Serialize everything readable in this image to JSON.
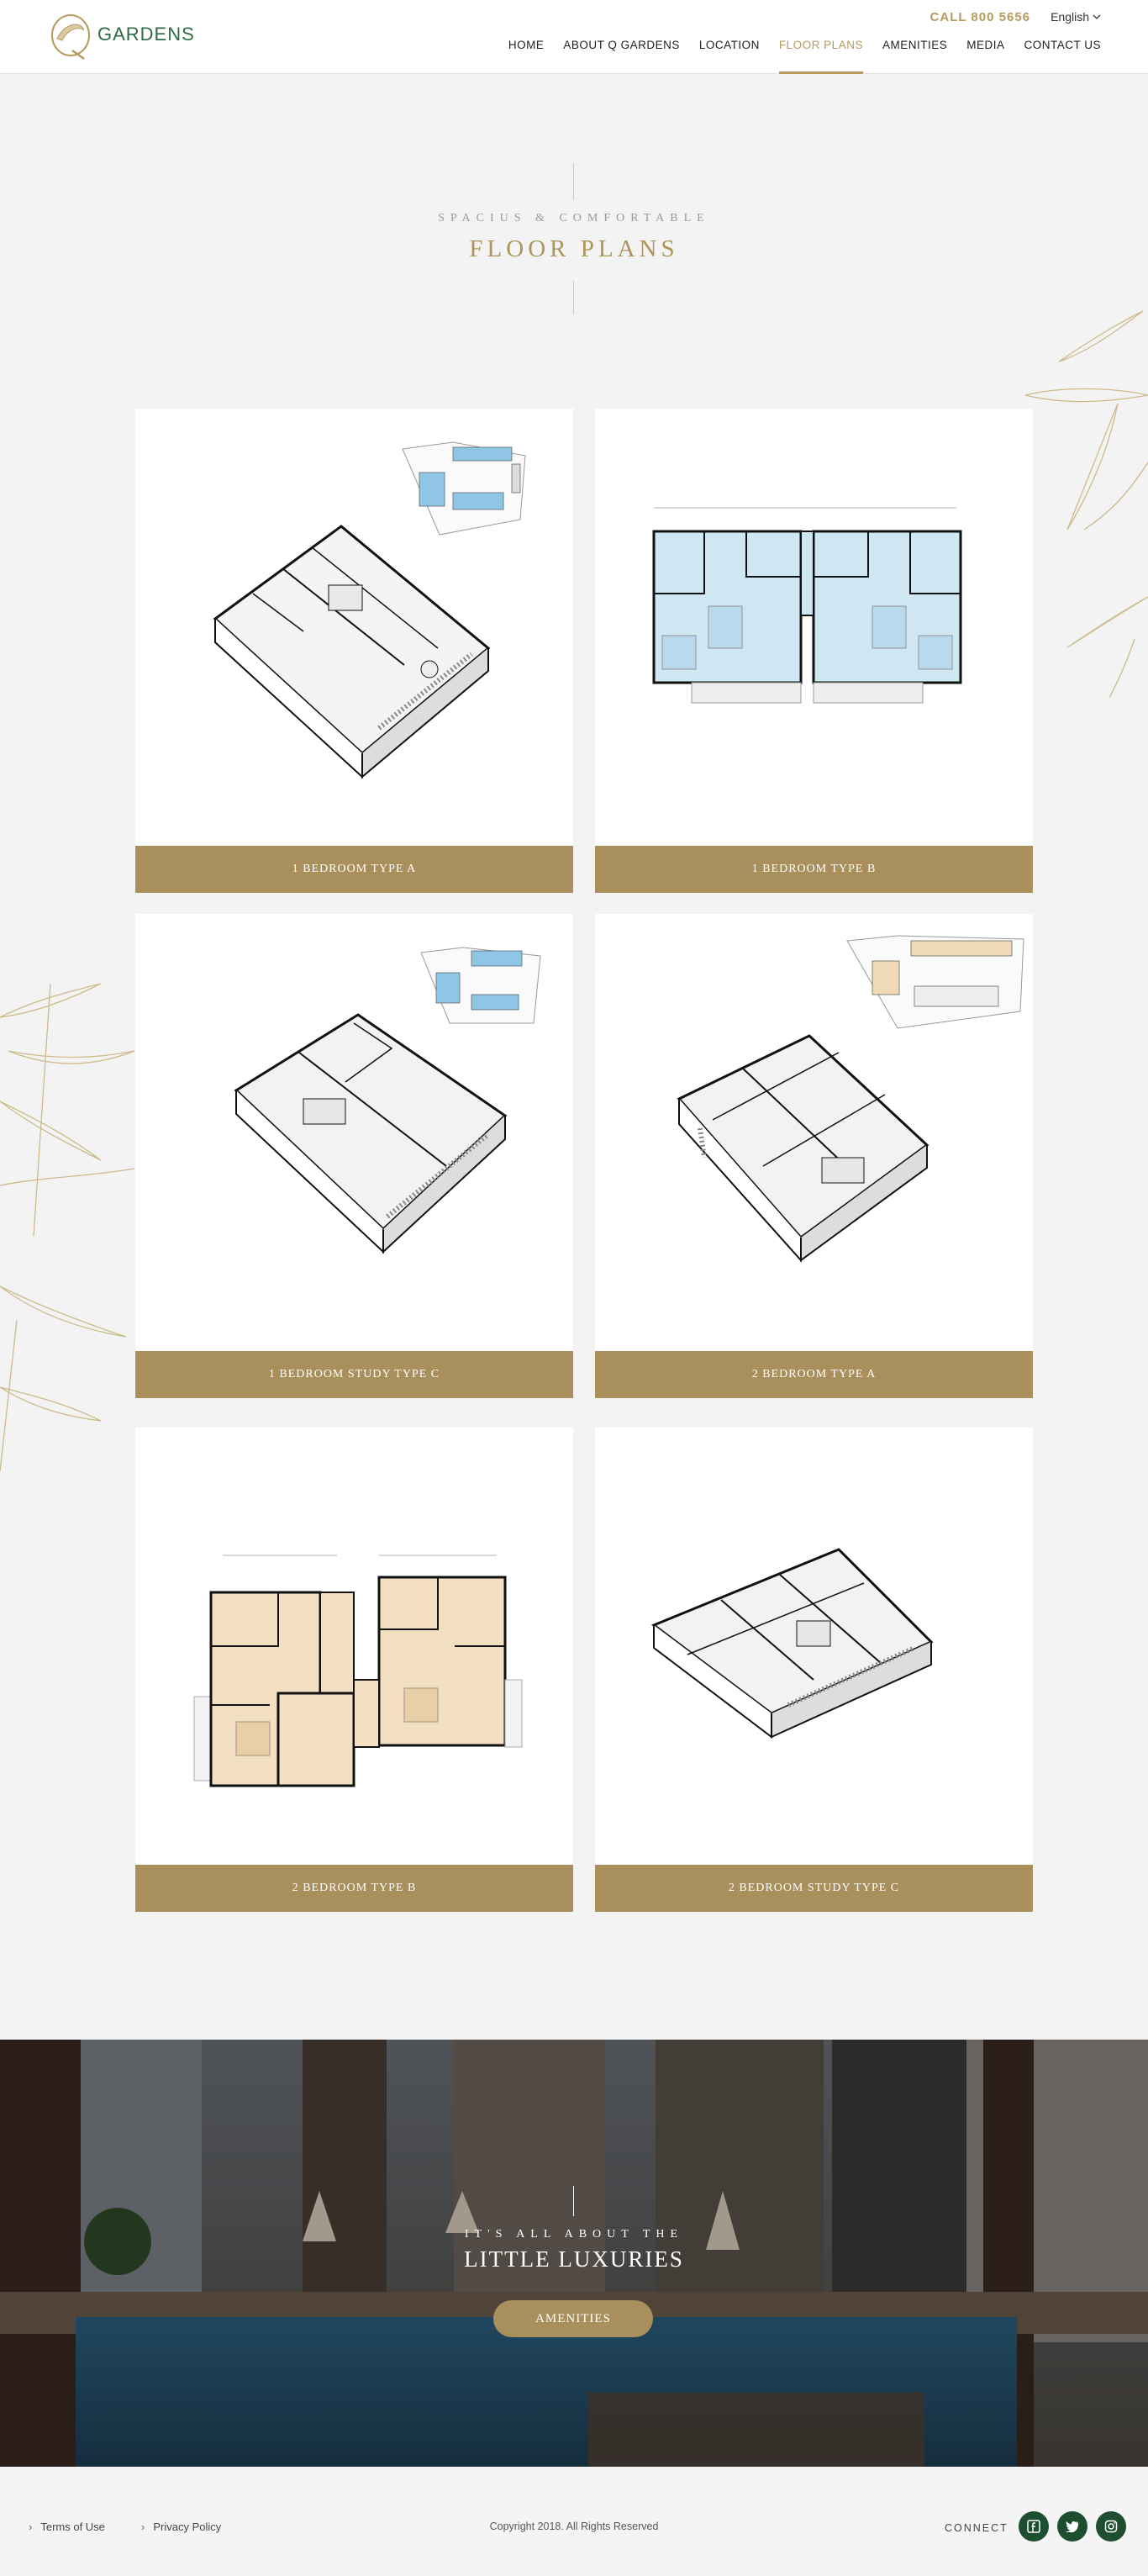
{
  "header": {
    "logo_text": "GARDENS",
    "call_label": "CALL 800 5656",
    "language": "English",
    "nav": [
      {
        "label": "HOME",
        "active": false
      },
      {
        "label": "ABOUT Q GARDENS",
        "active": false
      },
      {
        "label": "LOCATION",
        "active": false
      },
      {
        "label": "FLOOR PLANS",
        "active": true
      },
      {
        "label": "AMENITIES",
        "active": false
      },
      {
        "label": "MEDIA",
        "active": false
      },
      {
        "label": "CONTACT US",
        "active": false
      }
    ]
  },
  "section": {
    "eyebrow": "SPACIUS & COMFORTABLE",
    "title": "FLOOR PLANS"
  },
  "plans": [
    {
      "label": "1 BEDROOM TYPE A",
      "plan_style": "isometric-keymap-blue"
    },
    {
      "label": "1 BEDROOM TYPE B",
      "plan_style": "flat-blue"
    },
    {
      "label": "1 BEDROOM STUDY TYPE C",
      "plan_style": "isometric-keymap-blue"
    },
    {
      "label": "2 BEDROOM TYPE A",
      "plan_style": "isometric-keymap-orange"
    },
    {
      "label": "2 BEDROOM TYPE B",
      "plan_style": "flat-beige"
    },
    {
      "label": "2 BEDROOM STUDY TYPE C",
      "plan_style": "isometric"
    }
  ],
  "banner": {
    "eyebrow": "IT'S ALL ABOUT THE",
    "title": "LITTLE LUXURIES",
    "button_label": "AMENITIES"
  },
  "footer": {
    "terms": "Terms of Use",
    "privacy": "Privacy Policy",
    "copyright": "Copyright 2018. All Rights Reserved",
    "connect": "CONNECT",
    "social": [
      "facebook-icon",
      "twitter-icon",
      "instagram-icon"
    ]
  },
  "colors": {
    "gold": "#a88f5b",
    "accent_gold": "#b59b5d",
    "dark_green": "#1d4e30",
    "brand_green": "#2e6b43"
  }
}
